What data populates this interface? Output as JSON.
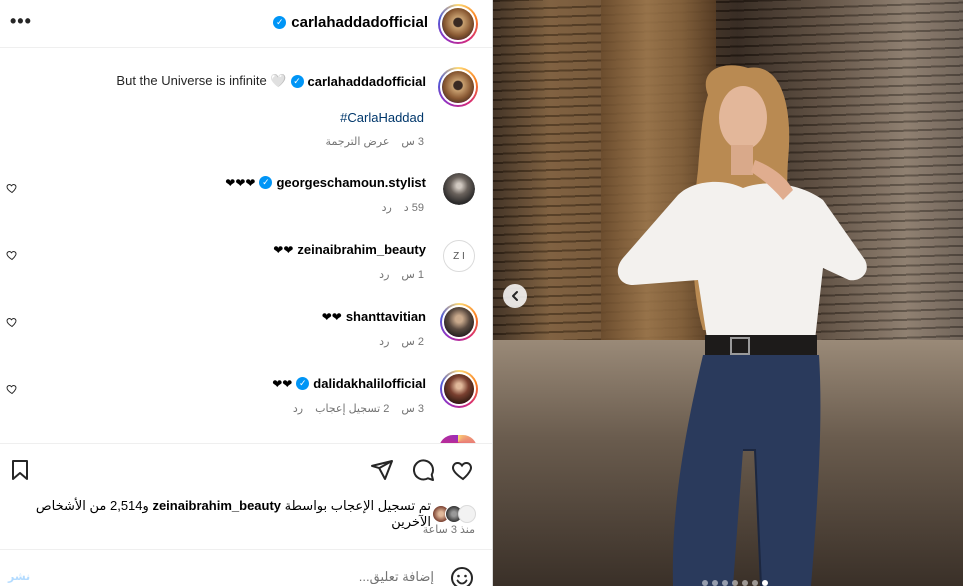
{
  "header": {
    "more_glyph": "•••",
    "author": "carlahaddadofficial"
  },
  "caption": {
    "text": "But the Universe is infinite 🤍",
    "author": "carlahaddadofficial",
    "hashtag": "#CarlaHaddad",
    "time": "3 س",
    "translate": "عرض الترجمة"
  },
  "comments": [
    {
      "username": "georgeschamoun.stylist",
      "verified": true,
      "text": "❤❤❤",
      "time": "59 د",
      "reply": "رد"
    },
    {
      "username": "zeinaibrahim_beauty",
      "verified": false,
      "text": "❤❤",
      "time": "1 س",
      "reply": "رد",
      "avatar_text": "Z I"
    },
    {
      "username": "shanttavitian",
      "verified": false,
      "text": "❤❤",
      "time": "2 س",
      "reply": "رد"
    },
    {
      "username": "dalidakhalilofficial",
      "verified": true,
      "text": "❤❤",
      "time": "3 س",
      "likes": "2 تسجيل إعجاب",
      "reply": "رد"
    }
  ],
  "likes": {
    "prefix": "تم تسجيل الإعجاب بواسطة",
    "user": "zeinaibrahim_beauty",
    "suffix": "و2,514 من الأشخاص الآخرين",
    "time_ago": "منذ 3 ساعة"
  },
  "add_comment": {
    "placeholder": "إضافة تعليق...",
    "post_label": "نشر"
  },
  "carousel": {
    "dot_count": 7,
    "active_index": 6
  },
  "colors": {
    "verified": "#0095f6",
    "hashtag": "#00376b",
    "muted": "#737373"
  }
}
